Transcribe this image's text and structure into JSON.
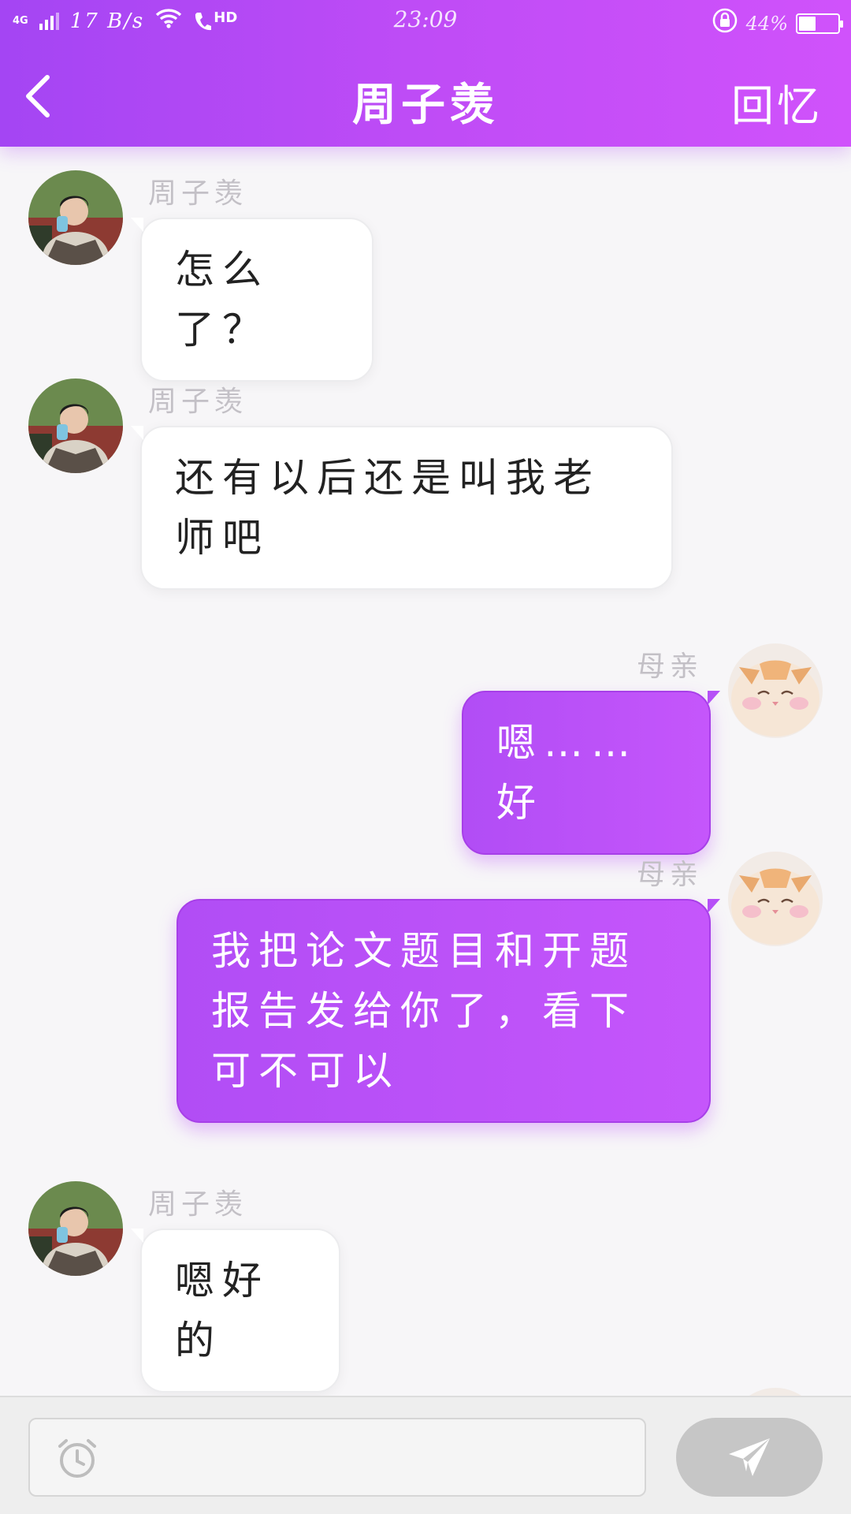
{
  "status_bar": {
    "network_type": "4G",
    "speed": "17 B/s",
    "hd_label": "HD",
    "time": "23:09",
    "battery_percent": "44%",
    "battery_level": 0.44
  },
  "header": {
    "title": "周子羡",
    "right_action": "回忆",
    "back_icon": "chevron-left-icon"
  },
  "messages": [
    {
      "side": "left",
      "sender": "周子羡",
      "text": "怎么了？"
    },
    {
      "side": "left",
      "sender": "周子羡",
      "text": "还有以后还是叫我老师吧"
    },
    {
      "side": "right",
      "sender": "母亲",
      "text": "嗯……好"
    },
    {
      "side": "right",
      "sender": "母亲",
      "text": "我把论文题目和开题报告发给你了，看下可不可以"
    },
    {
      "side": "left",
      "sender": "周子羡",
      "text": "嗯好的"
    }
  ],
  "input": {
    "value": "",
    "placeholder": "",
    "alarm_icon": "alarm-clock-icon",
    "send_icon": "paper-plane-icon"
  },
  "colors": {
    "header_start": "#a445f3",
    "header_end": "#d052fb",
    "bubble_outgoing": "#bf52f8",
    "bubble_incoming": "#ffffff",
    "send_button": "#c6c6c6"
  }
}
